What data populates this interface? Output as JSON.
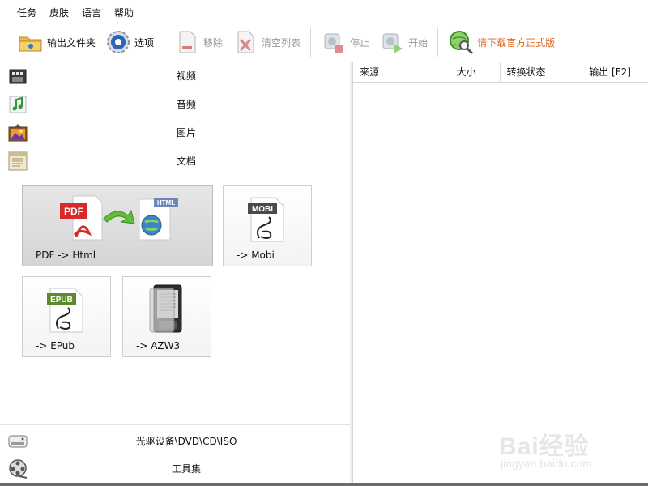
{
  "menu": [
    "任务",
    "皮肤",
    "语言",
    "帮助"
  ],
  "toolbar": {
    "output_folder": "输出文件夹",
    "options": "选项",
    "remove": "移除",
    "clear_list": "清空列表",
    "stop": "停止",
    "start": "开始",
    "download": "请下载官方正式版"
  },
  "categories": {
    "video": "视频",
    "audio": "音频",
    "image": "图片",
    "document": "文档"
  },
  "tiles": {
    "pdf_html": "PDF -> Html",
    "mobi": "-> Mobi",
    "epub": "-> EPub",
    "azw3": "-> AZW3",
    "pdf_badge": "PDF",
    "html_badge": "HTML",
    "mobi_badge": "MOBI",
    "epub_badge": "EPUB"
  },
  "bottom": {
    "optical": "光驱设备\\DVD\\CD\\ISO",
    "toolset": "工具集"
  },
  "table": {
    "columns": [
      "来源",
      "大小",
      "转换状态",
      "输出 [F2]"
    ]
  },
  "colors": {
    "accent": "#e0671e",
    "pdf_red": "#d62b2b",
    "arrow_green": "#5fbf3a"
  },
  "watermark": {
    "logo": "Bai经验",
    "url": "jingyan.baidu.com"
  }
}
